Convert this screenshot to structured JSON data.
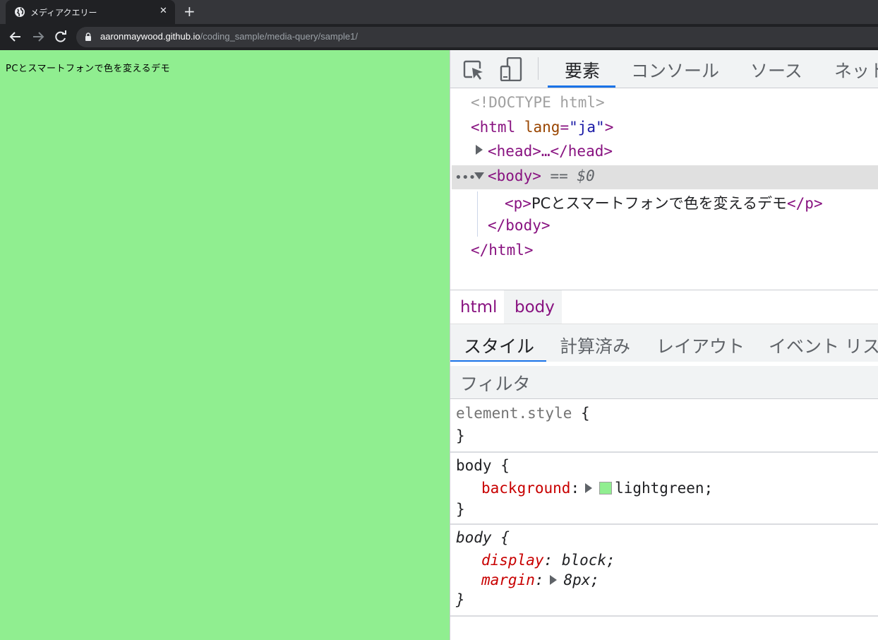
{
  "browser": {
    "tab_title": "メディアクエリー",
    "tab_close": "✕",
    "new_tab": "+",
    "url_host": "aaronmaywood.github.io",
    "url_path": "/coding_sample/media-query/sample1/"
  },
  "page": {
    "background": "#90ee90",
    "text": "PCとスマートフォンで色を変えるデモ"
  },
  "devtools": {
    "tabs": [
      {
        "label": "要素",
        "active": true
      },
      {
        "label": "コンソール",
        "active": false
      },
      {
        "label": "ソース",
        "active": false
      },
      {
        "label": "ネット",
        "active": false
      }
    ],
    "dom": {
      "doctype": "<!DOCTYPE html>",
      "html_open_tag": "<html",
      "html_attr_name": "lang",
      "html_attr_eq": "=",
      "html_attr_value": "\"ja\"",
      "html_open_close": ">",
      "head_collapsed": "<head>…</head>",
      "body_open": "<body>",
      "body_selected_suffix": "== $0",
      "selection_dots": "•••",
      "p_open": "<p>",
      "p_text": "PCとスマートフォンで色を変えるデモ",
      "p_close": "</p>",
      "body_close": "</body>",
      "html_close": "</html>"
    },
    "breadcrumbs": [
      "html",
      "body"
    ],
    "subtabs": [
      {
        "label": "スタイル",
        "active": true
      },
      {
        "label": "計算済み",
        "active": false
      },
      {
        "label": "レイアウト",
        "active": false
      },
      {
        "label": "イベント リスナ",
        "active": false
      }
    ],
    "filter_placeholder": "フィルタ",
    "styles": {
      "element_style_selector": "element.style",
      "open_brace": "{",
      "close_brace": "}",
      "rule1_selector": "body",
      "rule1_prop": "background",
      "rule1_value": "lightgreen",
      "rule1_swatch_color": "#90ee90",
      "rule2_selector": "body",
      "rule2_prop1": "display",
      "rule2_val1": "block",
      "rule2_prop2": "margin",
      "rule2_val2": "8px",
      "colon": ":",
      "semicolon": ";"
    }
  }
}
